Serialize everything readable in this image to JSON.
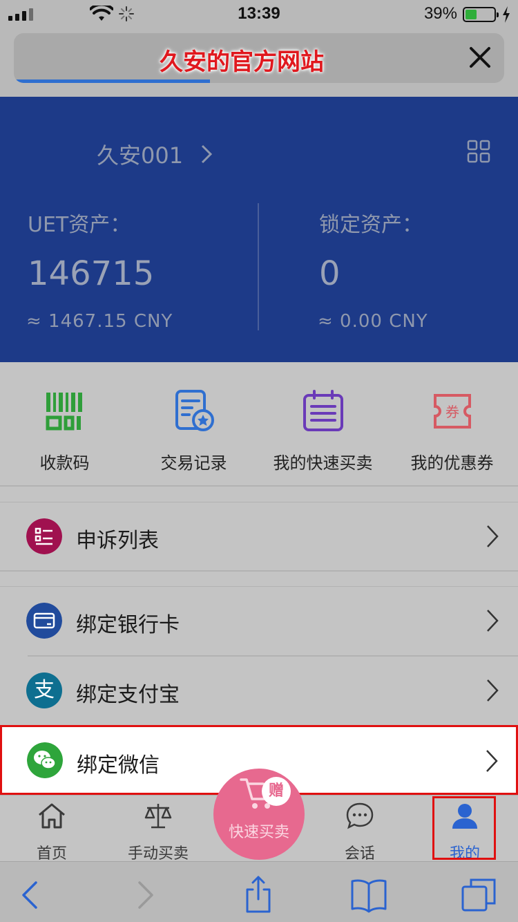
{
  "status_bar": {
    "time": "13:39",
    "battery_percent": "39%",
    "battery_level": 0.39
  },
  "browser": {
    "page_title": "久安的官方网站",
    "load_progress": 0.4
  },
  "account": {
    "name": "久安001",
    "assets": [
      {
        "label": "UET资产：",
        "value": "146715",
        "cny": "≈  1467.15  CNY"
      },
      {
        "label": "锁定资产：",
        "value": "0",
        "cny": "≈  0.00  CNY"
      }
    ]
  },
  "shortcuts": [
    {
      "label": "收款码",
      "icon": "qr-code-icon",
      "color": "#2f9e3a"
    },
    {
      "label": "交易记录",
      "icon": "transaction-record-icon",
      "color": "#2f6fd0"
    },
    {
      "label": "我的快速买卖",
      "icon": "calendar-list-icon",
      "color": "#6a3ab8"
    },
    {
      "label": "我的优惠券",
      "icon": "coupon-icon",
      "color": "#d65a63"
    }
  ],
  "coupon_icon_text": "券",
  "menu": {
    "appeal": {
      "label": "申诉列表",
      "color": "#a0114f"
    },
    "bank_card": {
      "label": "绑定银行卡",
      "color": "#214b9c"
    },
    "alipay": {
      "label": "绑定支付宝",
      "color": "#0e6f90",
      "glyph": "支"
    },
    "wechat": {
      "label": "绑定微信",
      "color": "#2ea53b"
    }
  },
  "tabbar": {
    "tabs": [
      {
        "label": "首页",
        "icon": "home-icon"
      },
      {
        "label": "手动买卖",
        "icon": "scale-icon"
      },
      {
        "label": "会话",
        "icon": "chat-icon"
      },
      {
        "label": "我的",
        "icon": "user-icon"
      }
    ],
    "fab_label": "快速买卖",
    "fab_badge": "赠",
    "active_color": "#2a63d0"
  }
}
